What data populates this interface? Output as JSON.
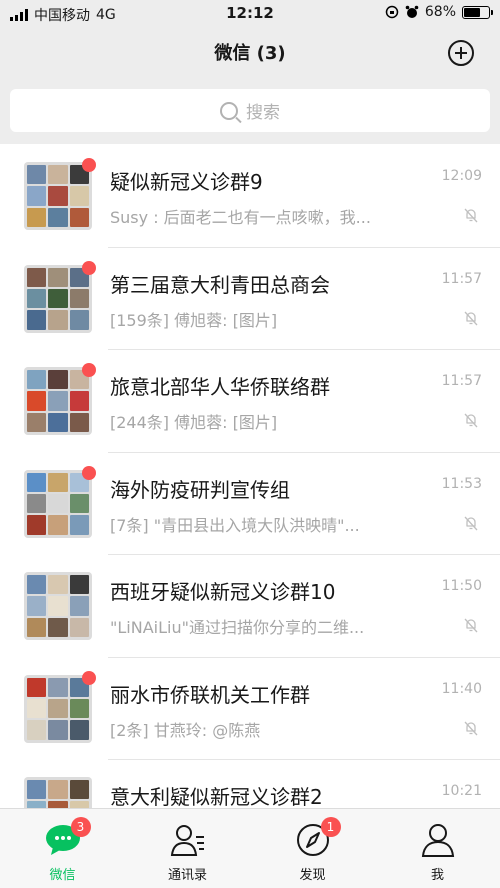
{
  "status_bar": {
    "carrier": "中国移动",
    "network": "4G",
    "time": "12:12",
    "battery": "68%",
    "battery_level": 0.68
  },
  "nav": {
    "title": "微信 (3)"
  },
  "search": {
    "placeholder": "搜索"
  },
  "chats": [
    {
      "name": "疑似新冠义诊群9",
      "preview": "Susy : 后面老二也有一点咳嗽，我...",
      "time": "12:09",
      "unread_dot": true,
      "muted": true,
      "avatar_colors": [
        "#6e88a8",
        "#c9b39b",
        "#3b3b3b",
        "#8aa6c8",
        "#a94a3f",
        "#d7c8a8",
        "#c79a4f",
        "#5c7f9e",
        "#b05a3a"
      ]
    },
    {
      "name": "第三届意大利青田总商会",
      "preview": "[159条] 傅旭蓉: [图片]",
      "time": "11:57",
      "unread_dot": true,
      "muted": true,
      "avatar_colors": [
        "#7e5a4a",
        "#9f8f7a",
        "#5b6f88",
        "#6b8fa0",
        "#3f5e3a",
        "#8c7b6a",
        "#4a6a8f",
        "#b7a38c",
        "#6f8aa3"
      ]
    },
    {
      "name": "旅意北部华人华侨联络群",
      "preview": "[244条] 傅旭蓉: [图片]",
      "time": "11:57",
      "unread_dot": true,
      "muted": true,
      "avatar_colors": [
        "#7fa3c0",
        "#5a3f3a",
        "#c8b4a0",
        "#d94a2a",
        "#8aa0b8",
        "#c63a3a",
        "#9a7f6a",
        "#4c6f9a",
        "#7a5a4a"
      ]
    },
    {
      "name": "海外防疫研判宣传组",
      "preview": "[7条] \"青田县出入境大队洪映晴\"...",
      "time": "11:53",
      "unread_dot": true,
      "muted": true,
      "avatar_colors": [
        "#5b8fc7",
        "#c8a56a",
        "#a8c0d8",
        "#8a8a8a",
        "#d8d8d8",
        "#6a8f6a",
        "#a03a2a",
        "#c7a07a",
        "#7a9ab8"
      ]
    },
    {
      "name": "西班牙疑似新冠义诊群10",
      "preview": "\"LiNAiLiu\"通过扫描你分享的二维...",
      "time": "11:50",
      "unread_dot": false,
      "muted": true,
      "avatar_colors": [
        "#6a8ab0",
        "#d8c8b0",
        "#3a3a3a",
        "#9ab0c8",
        "#e8e0d0",
        "#8aa0b8",
        "#b08a5a",
        "#6f5a4a",
        "#c8b8a8"
      ]
    },
    {
      "name": "丽水市侨联机关工作群",
      "preview": "[2条] 甘燕玲: @陈燕",
      "time": "11:40",
      "unread_dot": true,
      "muted": true,
      "avatar_colors": [
        "#c0392b",
        "#8a9ab0",
        "#5a7a9a",
        "#e8e0d0",
        "#b8a48a",
        "#6a8a5a",
        "#d8d0c0",
        "#7a8aa0",
        "#4a5a6a"
      ]
    },
    {
      "name": "意大利疑似新冠义诊群2",
      "preview": "",
      "time": "10:21",
      "unread_dot": false,
      "muted": false,
      "avatar_colors": [
        "#6a8ab0",
        "#c8a88a",
        "#5a4a3a",
        "#8ab0c8",
        "#a85a3a",
        "#d8c8a8",
        "#7a9a6a",
        "#b8b8c8",
        "#9a6a5a"
      ]
    }
  ],
  "tabs": [
    {
      "label": "微信",
      "icon": "chat-bubble-icon",
      "badge": "3",
      "active": true
    },
    {
      "label": "通讯录",
      "icon": "contacts-icon",
      "badge": "",
      "active": false
    },
    {
      "label": "发现",
      "icon": "compass-icon",
      "badge": "1",
      "active": false
    },
    {
      "label": "我",
      "icon": "person-icon",
      "badge": "",
      "active": false
    }
  ],
  "colors": {
    "accent": "#07c160",
    "badge": "#fa5151",
    "background": "#ededed",
    "muted_text": "#a6a6a6"
  }
}
